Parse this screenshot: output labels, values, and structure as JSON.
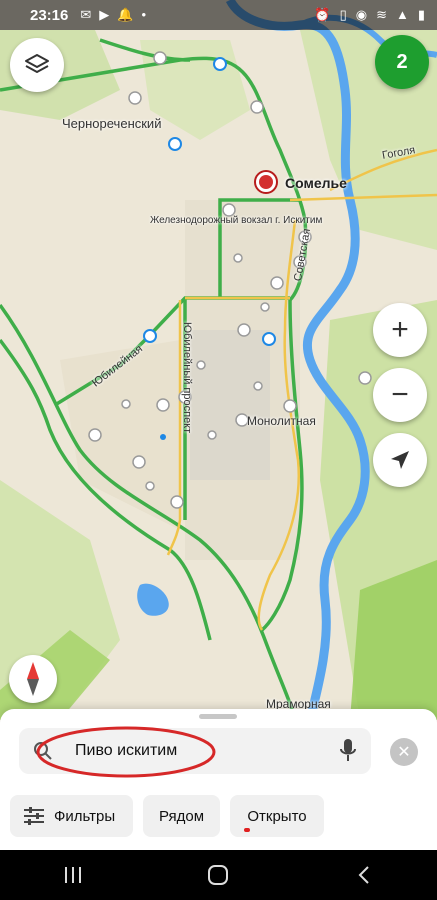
{
  "status_bar": {
    "time": "23:16",
    "left_icons": [
      "message-icon",
      "youtube-icon",
      "notification-icon",
      "dot-icon"
    ],
    "right_icons": [
      "alarm-icon",
      "vibrate-icon",
      "location-icon",
      "wifi-icon",
      "signal-icon",
      "battery-icon"
    ]
  },
  "map": {
    "labels": {
      "chernorechensky": "Чернореченский",
      "gogolya": "Гоголя",
      "somelie": "Сомелье",
      "station": "Железнодорожный вокзал г. Искитим",
      "sovetskaya": "Советская",
      "yubileynaya": "Юбилейная",
      "yubileyny_prospekt": "Юбилейный проспект",
      "monolitnaya": "Монолитная",
      "mramornaya": "Мраморная"
    },
    "colors": {
      "water": "#4b9ff0",
      "forest": "#b7d98c",
      "road_green": "#3fae49",
      "road_yellow": "#f0c44a",
      "poi_blue": "#1e88e5"
    }
  },
  "controls": {
    "layers_icon": "layers-icon",
    "result_count": "2",
    "zoom_in_label": "+",
    "zoom_out_label": "−",
    "locate_icon": "navigation-arrow-icon",
    "compass_icon": "compass-icon"
  },
  "search": {
    "query": "Пиво искитим",
    "search_icon": "search-icon",
    "mic_icon": "microphone-icon",
    "clear_icon": "close-icon",
    "clear_label": "✕"
  },
  "chips": {
    "filters": "Фильтры",
    "nearby": "Рядом",
    "open_now": "Открыто"
  },
  "navbar": {
    "recents_icon": "recents-icon",
    "home_icon": "home-icon",
    "back_icon": "back-icon"
  }
}
